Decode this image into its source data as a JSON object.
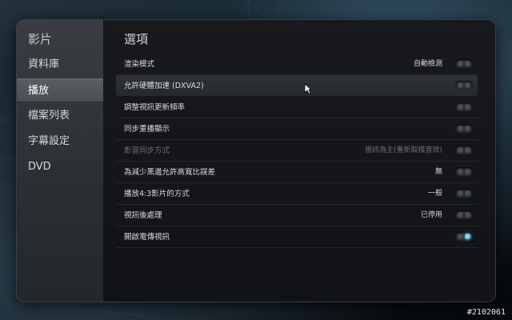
{
  "sidebar": {
    "title": "影片",
    "items": [
      {
        "label": "資料庫",
        "active": false
      },
      {
        "label": "播放",
        "active": true
      },
      {
        "label": "檔案列表",
        "active": false
      },
      {
        "label": "字幕設定",
        "active": false
      },
      {
        "label": "DVD",
        "active": false
      }
    ]
  },
  "main": {
    "title": "選項",
    "rows": [
      {
        "label": "渲染模式",
        "value": "自動檢測",
        "toggle": "off",
        "state": "normal"
      },
      {
        "label": "允許硬體加速 (DXVA2)",
        "value": "",
        "toggle": "off",
        "state": "highlight"
      },
      {
        "label": "調整視訊更新頻率",
        "value": "",
        "toggle": "off",
        "state": "normal"
      },
      {
        "label": "同步重播顯示",
        "value": "",
        "toggle": "off",
        "state": "normal"
      },
      {
        "label": "影音同步方式",
        "value": "視訊為主(重新取樣音效)",
        "toggle": "off",
        "state": "disabled"
      },
      {
        "label": "為減少黑邊允許高寬比誤差",
        "value": "無",
        "toggle": "off",
        "state": "normal"
      },
      {
        "label": "播放4:3影片的方式",
        "value": "一般",
        "toggle": "off",
        "state": "normal"
      },
      {
        "label": "視訊後處理",
        "value": "已停用",
        "toggle": "off",
        "state": "normal"
      },
      {
        "label": "開啟電傳視訊",
        "value": "",
        "toggle": "on",
        "state": "normal"
      }
    ]
  },
  "watermark": "#2102061",
  "colors": {
    "accent": "#7ad2f0"
  }
}
